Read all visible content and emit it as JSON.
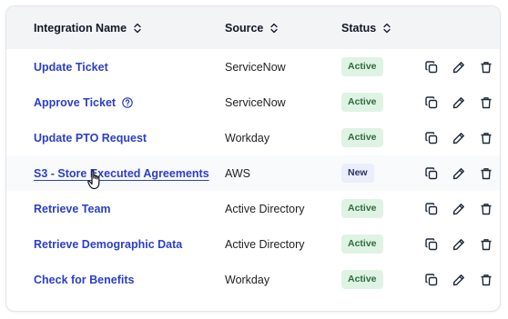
{
  "table": {
    "columns": {
      "name": "Integration Name",
      "source": "Source",
      "status": "Status"
    },
    "rows": [
      {
        "name": "Update Ticket",
        "source": "ServiceNow",
        "status": "Active"
      },
      {
        "name": "Approve Ticket",
        "source": "ServiceNow",
        "status": "Active"
      },
      {
        "name": "Update PTO Request",
        "source": "Workday",
        "status": "Active"
      },
      {
        "name": "S3 - Store Executed Agreements",
        "source": "AWS",
        "status": "New"
      },
      {
        "name": "Retrieve Team",
        "source": "Active Directory",
        "status": "Active"
      },
      {
        "name": "Retrieve Demographic Data",
        "source": "Active Directory",
        "status": "Active"
      },
      {
        "name": "Check for Benefits",
        "source": "Workday",
        "status": "Active"
      }
    ]
  },
  "icons": {
    "sort": "sort-arrows-icon",
    "help": "help-circle-icon",
    "copy": "copy-icon",
    "edit": "pencil-icon",
    "delete": "trash-icon",
    "cursor": "hand-pointer-icon"
  },
  "colors": {
    "link": "#2b3fc7",
    "active_bg": "#dff3e4",
    "active_text": "#2f6b3d",
    "new_bg": "#ebeefb",
    "new_text": "#2d2f6b",
    "header_bg": "#f3f4f6"
  }
}
